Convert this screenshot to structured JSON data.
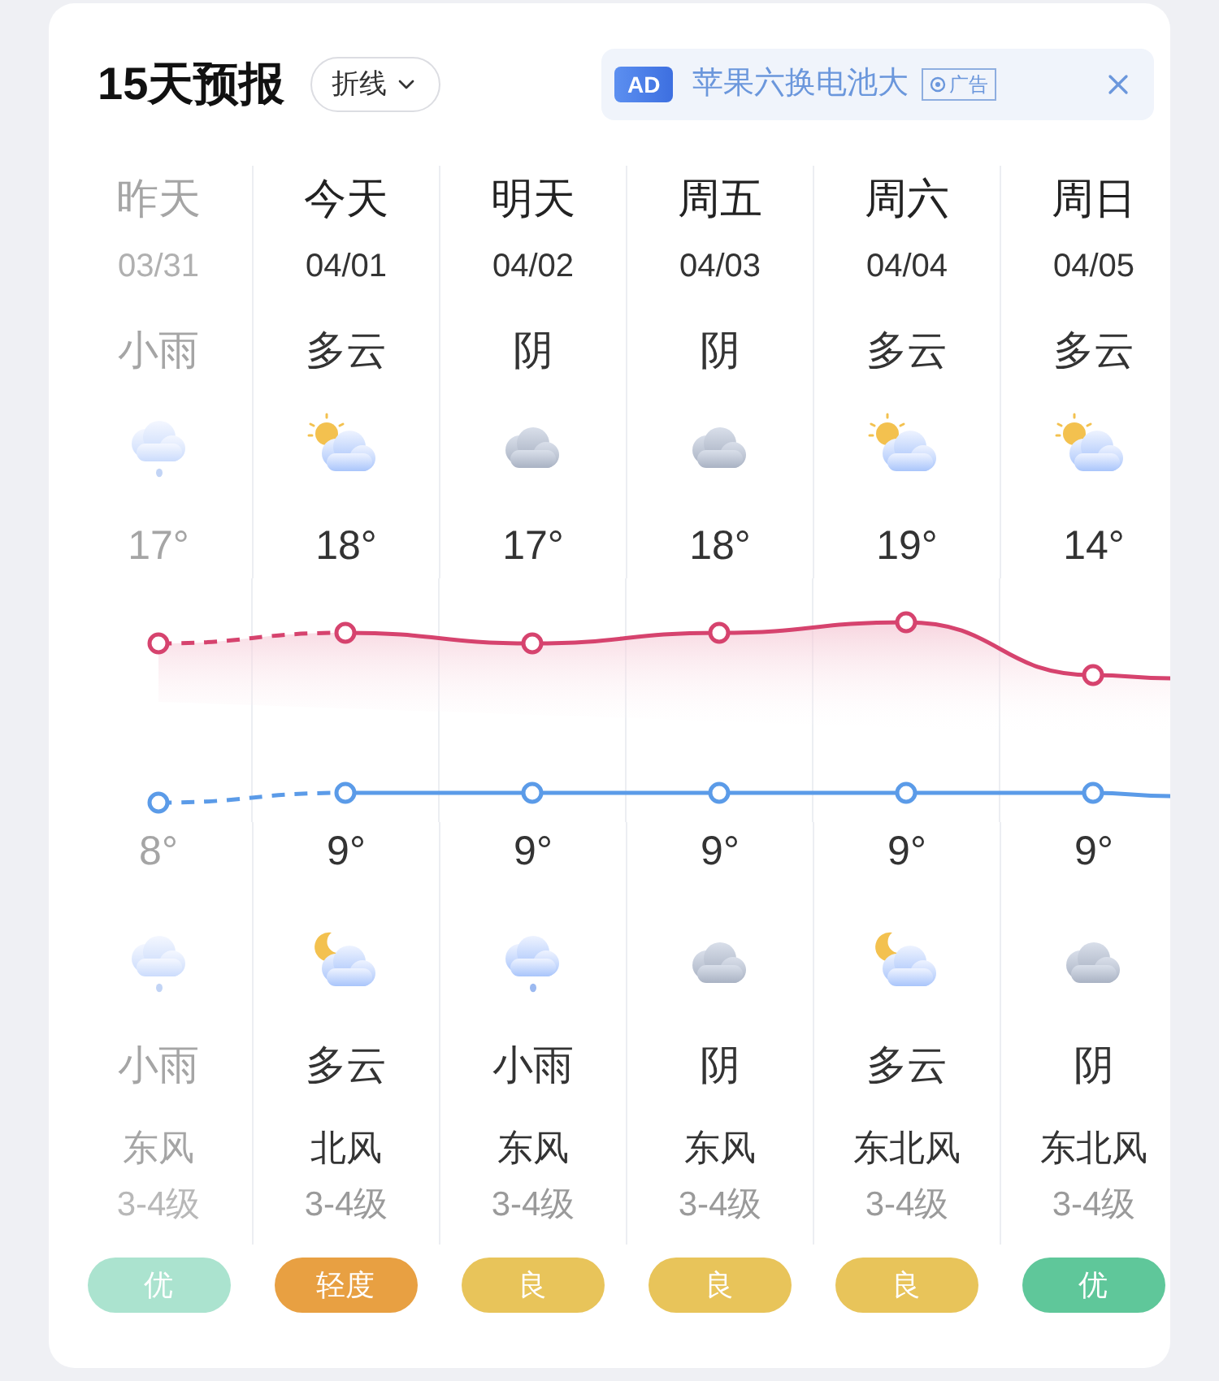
{
  "title": "15天预报",
  "view_toggle": {
    "label": "折线"
  },
  "ad": {
    "badge": "AD",
    "text": "苹果六换电池大",
    "tag": "广告"
  },
  "days": [
    {
      "name": "昨天",
      "date": "03/31",
      "past": true,
      "day": {
        "weather": "小雨",
        "kind": "light-rain"
      },
      "high": "17°",
      "low": "8°",
      "night": {
        "weather": "小雨",
        "kind": "light-rain"
      },
      "wind": "东风",
      "wind_level": "3-4级",
      "aqi": {
        "label": "优",
        "color": "#abe3cf"
      }
    },
    {
      "name": "今天",
      "date": "04/01",
      "past": false,
      "day": {
        "weather": "多云",
        "kind": "partly-cloudy-day"
      },
      "high": "18°",
      "low": "9°",
      "night": {
        "weather": "多云",
        "kind": "partly-cloudy-night"
      },
      "wind": "北风",
      "wind_level": "3-4级",
      "aqi": {
        "label": "轻度",
        "color": "#e8a042"
      }
    },
    {
      "name": "明天",
      "date": "04/02",
      "past": false,
      "day": {
        "weather": "阴",
        "kind": "overcast"
      },
      "high": "17°",
      "low": "9°",
      "night": {
        "weather": "小雨",
        "kind": "light-rain"
      },
      "wind": "东风",
      "wind_level": "3-4级",
      "aqi": {
        "label": "良",
        "color": "#e8c45a"
      }
    },
    {
      "name": "周五",
      "date": "04/03",
      "past": false,
      "day": {
        "weather": "阴",
        "kind": "overcast"
      },
      "high": "18°",
      "low": "9°",
      "night": {
        "weather": "阴",
        "kind": "overcast"
      },
      "wind": "东风",
      "wind_level": "3-4级",
      "aqi": {
        "label": "良",
        "color": "#e8c45a"
      }
    },
    {
      "name": "周六",
      "date": "04/04",
      "past": false,
      "day": {
        "weather": "多云",
        "kind": "partly-cloudy-day"
      },
      "high": "19°",
      "low": "9°",
      "night": {
        "weather": "多云",
        "kind": "partly-cloudy-night"
      },
      "wind": "东北风",
      "wind_level": "3-4级",
      "aqi": {
        "label": "良",
        "color": "#e8c45a"
      }
    },
    {
      "name": "周日",
      "date": "04/05",
      "past": false,
      "day": {
        "weather": "多云",
        "kind": "partly-cloudy-day"
      },
      "high": "14°",
      "low": "9°",
      "night": {
        "weather": "阴",
        "kind": "overcast"
      },
      "wind": "东北风",
      "wind_level": "3-4级",
      "aqi": {
        "label": "优",
        "color": "#5fc79a"
      }
    }
  ]
}
